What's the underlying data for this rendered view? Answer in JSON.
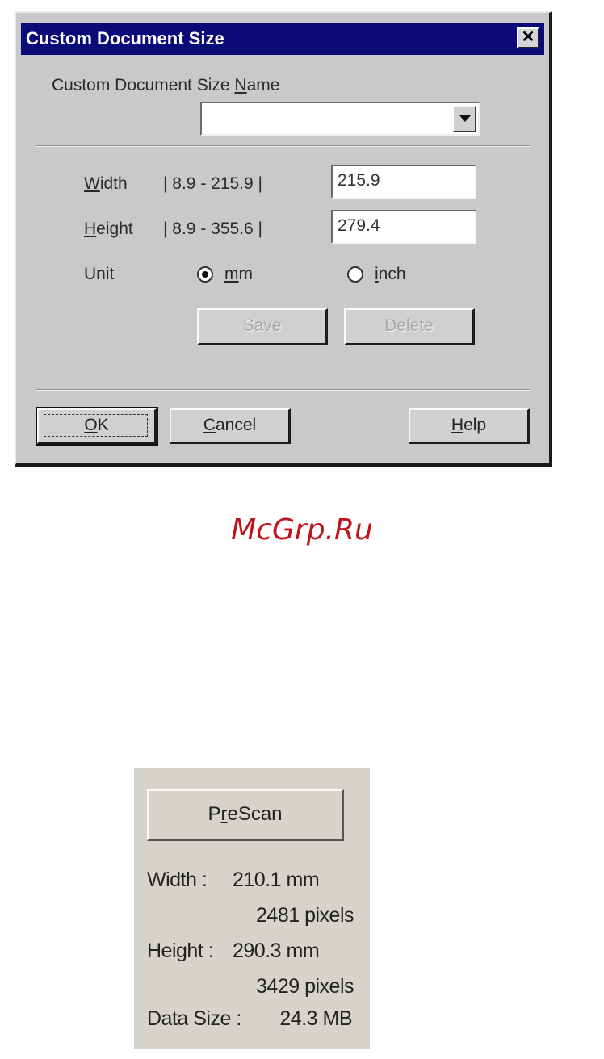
{
  "dialog": {
    "title": "Custom Document Size",
    "close_glyph": "✕",
    "name_label_prefix": "Custom Document Size ",
    "name_label_accel": "N",
    "name_label_rest": "ame",
    "name_combo_value": "",
    "width_label_accel": "W",
    "width_label_rest": "idth",
    "width_range": "|  8.9 - 215.9 |",
    "width_value": "215.9",
    "height_label_accel": "H",
    "height_label_rest": "eight",
    "height_range": "|  8.9 - 355.6 |",
    "height_value": "279.4",
    "unit_label": "Unit",
    "unit_mm_accel": "m",
    "unit_mm_rest": "m",
    "unit_inch_accel": "i",
    "unit_inch_rest": "nch",
    "unit_selected": "mm",
    "save_label": "Save",
    "delete_label": "Delete",
    "ok_accel": "O",
    "ok_rest": "K",
    "cancel_accel": "C",
    "cancel_rest": "ancel",
    "help_accel": "H",
    "help_rest": "elp"
  },
  "watermark": "McGrp.Ru",
  "panel": {
    "prescan_prefix": "P",
    "prescan_accel": "r",
    "prescan_rest": "eScan",
    "width_label": "Width :",
    "width_mm": "210.1 mm",
    "width_px": "2481 pixels",
    "height_label": "Height :",
    "height_mm": "290.3 mm",
    "height_px": "3429 pixels",
    "datasize_label": "Data Size :",
    "datasize_value": "24.3 MB"
  }
}
